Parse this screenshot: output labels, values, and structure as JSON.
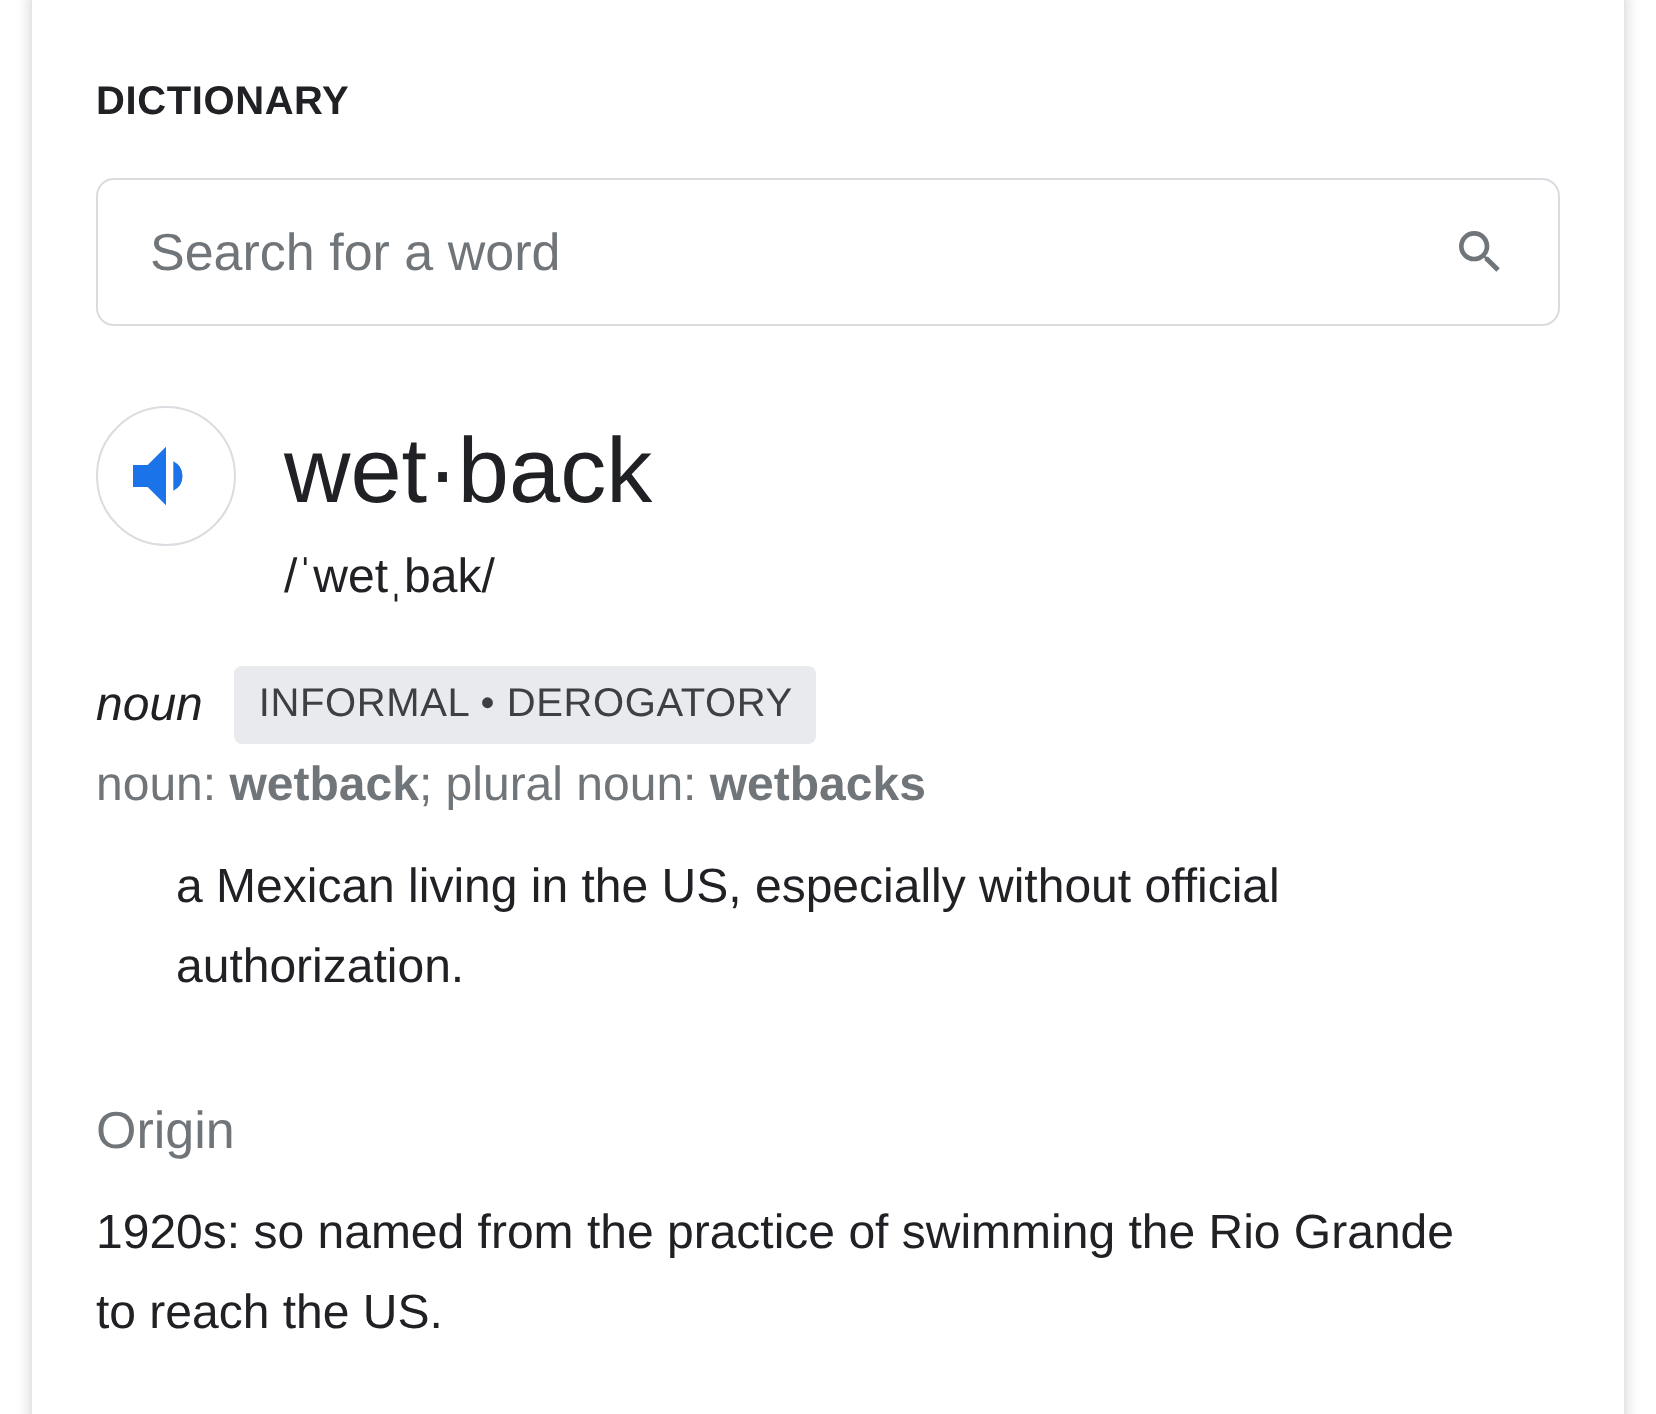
{
  "heading": "DICTIONARY",
  "search": {
    "placeholder": "Search for a word"
  },
  "entry": {
    "headword": "wet·back",
    "pronunciation": "/ˈwetˌbak/",
    "part_of_speech": "noun",
    "labels": "INFORMAL • DEROGATORY",
    "forms": "noun: **wetback**; plural noun: **wetbacks**",
    "definitions": [
      "a Mexican living in the US, especially without official authorization."
    ]
  },
  "origin": {
    "title": "Origin",
    "text": "1920s: so named from the practice of swimming the Rio Grande to reach the US."
  }
}
